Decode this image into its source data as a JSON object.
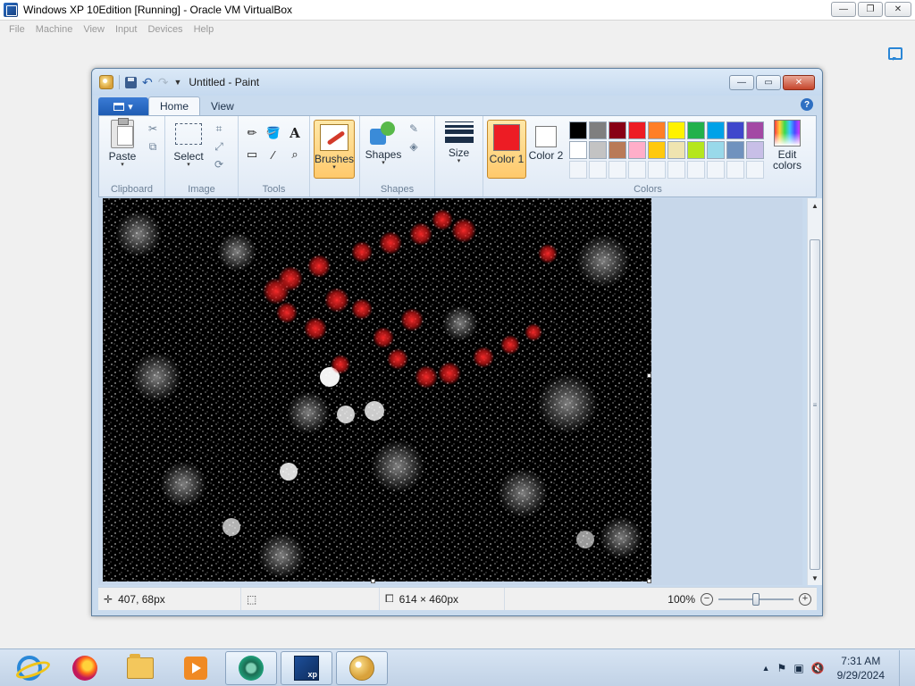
{
  "host": {
    "title": "Windows XP 10Edition [Running] - Oracle VM VirtualBox",
    "controls": {
      "minimize": "—",
      "restore": "❐",
      "close": "✕"
    },
    "menu": [
      "File",
      "Machine",
      "View",
      "Input",
      "Devices",
      "Help"
    ]
  },
  "paint": {
    "title": "Untitled - Paint",
    "controls": {
      "minimize": "—",
      "restore": "▭",
      "close": "✕"
    },
    "tabs": {
      "home": "Home",
      "view": "View"
    },
    "help": "?",
    "groups": {
      "clipboard": {
        "label": "Clipboard",
        "paste": "Paste"
      },
      "image": {
        "label": "Image",
        "select": "Select"
      },
      "tools": {
        "label": "Tools"
      },
      "brushes": {
        "label": "Brushes"
      },
      "shapes": {
        "label": "Shapes",
        "button": "Shapes"
      },
      "size": {
        "label": "Size"
      },
      "colors": {
        "label": "Colors",
        "color1": "Color 1",
        "color2": "Color 2",
        "edit": "Edit colors",
        "color1_value": "#ed1c24",
        "color2_value": "#ffffff",
        "palette_row1": [
          "#000000",
          "#7f7f7f",
          "#880015",
          "#ed1c24",
          "#ff7f27",
          "#fff200",
          "#22b14c",
          "#00a2e8",
          "#3f48cc",
          "#a349a4"
        ],
        "palette_row2": [
          "#ffffff",
          "#c3c3c3",
          "#b97a57",
          "#ffaec9",
          "#ffc90e",
          "#efe4b0",
          "#b5e61d",
          "#99d9ea",
          "#7092be",
          "#c8bfe7"
        ]
      }
    },
    "status": {
      "cursor_pos": "407, 68px",
      "selection_size": "",
      "image_size": "614 × 460px",
      "zoom": "100%",
      "zoom_fraction": 0.5
    }
  },
  "taskbar": {
    "apps": [
      "internet-explorer",
      "firefox",
      "file-explorer",
      "media-player",
      "anydesk",
      "virtualbox-xp",
      "paint"
    ],
    "xp_badge": "xp",
    "clock": {
      "time": "7:31 AM",
      "date": "9/29/2024"
    }
  }
}
